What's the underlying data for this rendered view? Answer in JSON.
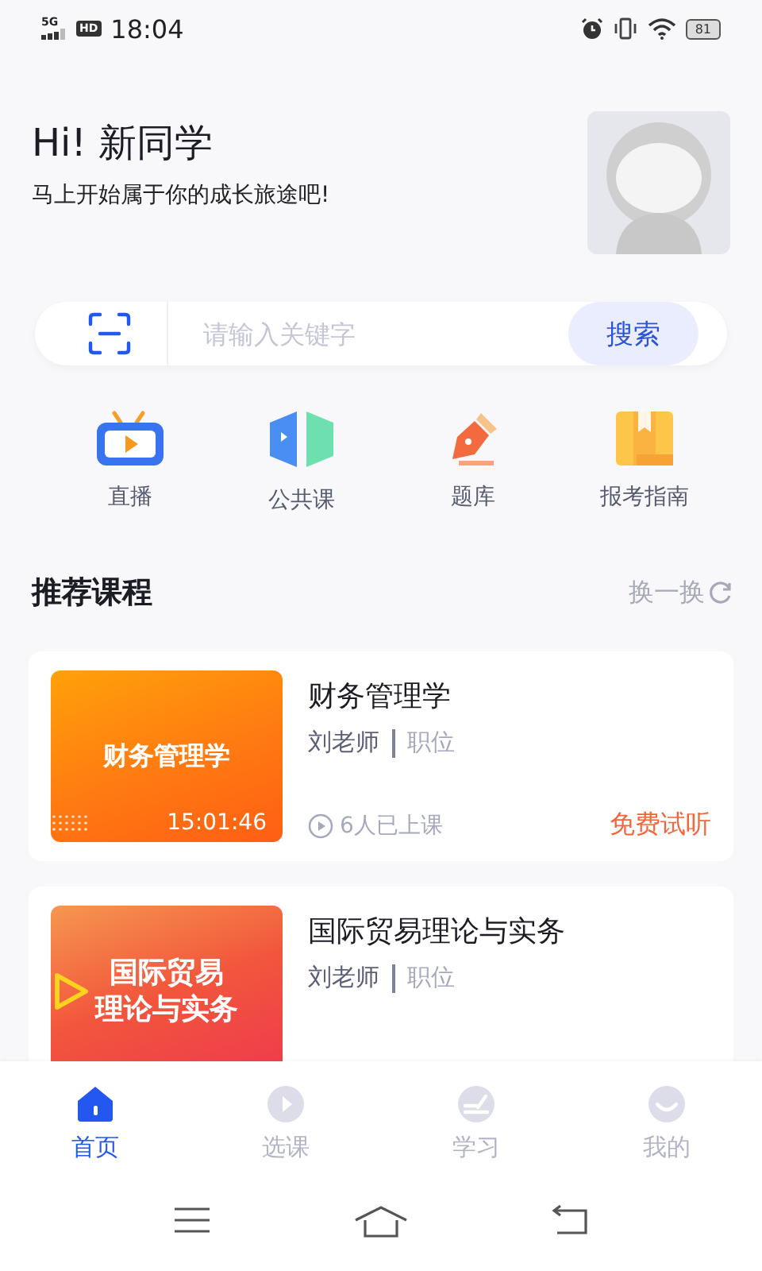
{
  "status_bar": {
    "network": "5G",
    "hd": "HD",
    "time": "18:04",
    "battery": "81"
  },
  "greeting": {
    "title": "Hi! 新同学",
    "subtitle": "马上开始属于你的成长旅途吧!"
  },
  "search": {
    "placeholder": "请输入关键字",
    "button": "搜索"
  },
  "shortcuts": [
    {
      "kind": "live",
      "label": "直播"
    },
    {
      "kind": "public",
      "label": "公共课"
    },
    {
      "kind": "bank",
      "label": "题库"
    },
    {
      "kind": "guide",
      "label": "报考指南"
    }
  ],
  "section": {
    "title": "推荐课程",
    "action": "换一换"
  },
  "courses": [
    {
      "kind": "orange",
      "thumb_lines": [
        "财务管理学"
      ],
      "duration": "15:01:46",
      "title": "财务管理学",
      "teacher": "刘老师",
      "position": "职位",
      "students": "6人已上课",
      "action": "免费试听"
    },
    {
      "kind": "red",
      "thumb_lines": [
        "国际贸易",
        "理论与实务"
      ],
      "title": "国际贸易理论与实务",
      "teacher": "刘老师",
      "position": "职位"
    }
  ],
  "tabs": [
    {
      "kind": "home",
      "label": "首页",
      "selected": true
    },
    {
      "kind": "courses",
      "label": "选课",
      "selected": false
    },
    {
      "kind": "study",
      "label": "学习",
      "selected": false
    },
    {
      "kind": "me",
      "label": "我的",
      "selected": false
    }
  ]
}
